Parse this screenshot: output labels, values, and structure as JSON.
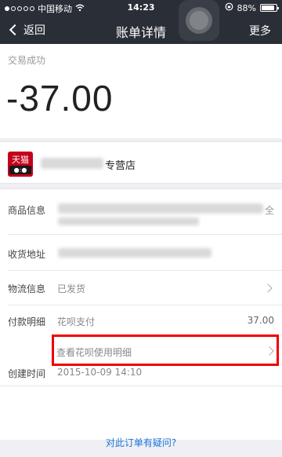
{
  "status_bar": {
    "carrier": "中国移动",
    "time": "14:23",
    "battery_percent": "88%",
    "battery_level": 0.88,
    "icons": [
      "signal-dots-icon",
      "wifi-icon",
      "lock-rotation-icon",
      "battery-icon"
    ]
  },
  "nav": {
    "back_label": "返回",
    "title": "账单详情",
    "more_label": "更多"
  },
  "summary": {
    "status": "交易成功",
    "amount": "-37.00"
  },
  "store": {
    "logo_text": "天猫",
    "logo_sub": "●:●",
    "name_suffix": "专营店"
  },
  "details": {
    "product_label": "商品信息",
    "product_tail": "全",
    "address_label": "收货地址",
    "logistics_label": "物流信息",
    "logistics_value": "已发货",
    "payment_label": "付款明细",
    "payment_method": "花呗支付",
    "payment_amount": "37.00",
    "huabei_link": "查看花呗使用明细",
    "created_label": "创建时间",
    "created_value": "2015-10-09 14:10"
  },
  "footer": {
    "question_link": "对此订单有疑问?"
  },
  "colors": {
    "header_bg": "#2a2e36",
    "highlight": "#e00000",
    "link": "#1a73d9",
    "tmall_red": "#c4001a"
  }
}
